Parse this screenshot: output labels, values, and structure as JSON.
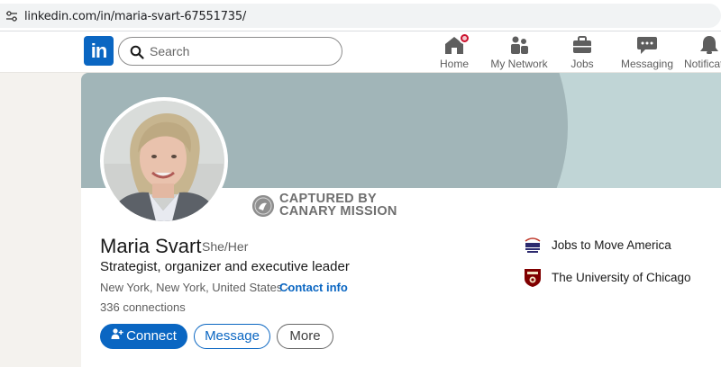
{
  "browser": {
    "url": "linkedin.com/in/maria-svart-67551735/"
  },
  "nav": {
    "logo_text": "in",
    "search_placeholder": "Search",
    "items": [
      {
        "label": "Home",
        "icon": "home-icon"
      },
      {
        "label": "My Network",
        "icon": "network-icon"
      },
      {
        "label": "Jobs",
        "icon": "briefcase-icon"
      },
      {
        "label": "Messaging",
        "icon": "messaging-icon"
      },
      {
        "label": "Notifications",
        "icon": "bell-icon"
      }
    ]
  },
  "watermark": {
    "line1": "CAPTURED BY",
    "line2": "CANARY MISSION"
  },
  "profile": {
    "name": "Maria Svart",
    "pronouns": "She/Her",
    "headline": "Strategist, organizer and executive leader",
    "location": "New York, New York, United States",
    "separator": "·",
    "contact_info": "Contact info",
    "connections_count": "336",
    "connections_label": "connections"
  },
  "actions": {
    "connect": "Connect",
    "message": "Message",
    "more": "More"
  },
  "organizations": [
    {
      "name": "Jobs to Move America",
      "logo_text": "JOBS TO MOVE AMERICA"
    },
    {
      "name": "The University of Chicago"
    }
  ],
  "colors": {
    "brand": "#0a66c2",
    "badge": "#cb112d",
    "banner_dark": "#a1b5b8",
    "banner_light": "#c0d5d6"
  }
}
